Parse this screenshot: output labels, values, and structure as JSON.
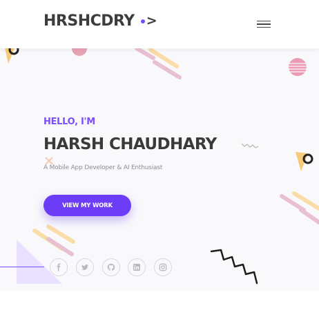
{
  "header": {
    "logo_text": "HRSHCDRY",
    "logo_chevron": ">",
    "menu_icon": "hamburger-menu-icon"
  },
  "hero": {
    "greeting": "HELLO, I'M",
    "name": "HARSH CHAUDHARY",
    "tagline": "A Mobile App Developer & AI Enthusiast",
    "cta_label": "VIEW MY WORK"
  },
  "social": [
    {
      "icon": "facebook-icon",
      "glyph": "f"
    },
    {
      "icon": "twitter-icon",
      "glyph": "t"
    },
    {
      "icon": "github-icon",
      "glyph": "gh"
    },
    {
      "icon": "linkedin-icon",
      "glyph": "in"
    },
    {
      "icon": "instagram-icon",
      "glyph": "ig"
    }
  ],
  "colors": {
    "accent": "#7c4dff",
    "button": "#6c3cf6",
    "text_dark": "#3a3a3a",
    "hero_bg": "#f9f9fb"
  }
}
